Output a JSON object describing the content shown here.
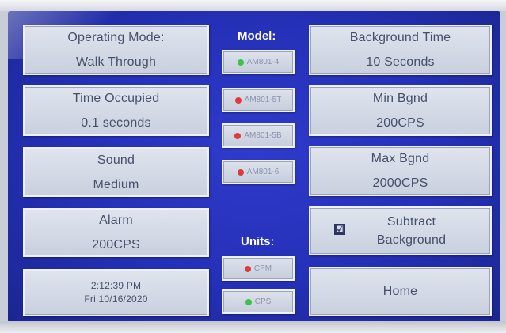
{
  "left": {
    "mode_label": "Operating Mode:",
    "mode_value": "Walk Through",
    "occupied_label": "Time Occupied",
    "occupied_value": "0.1 seconds",
    "sound_label": "Sound",
    "sound_value": "Medium",
    "alarm_label": "Alarm",
    "alarm_value": "200CPS",
    "clock_time": "2:12:39 PM",
    "clock_date": "Fri 10/16/2020"
  },
  "middle": {
    "model_header": "Model:",
    "models": [
      {
        "label": "AM801-4",
        "led": "#3cc24a"
      },
      {
        "label": "AM801-5T",
        "led": "#e03a3a"
      },
      {
        "label": "AM801-5B",
        "led": "#e03a3a"
      },
      {
        "label": "AM801-6",
        "led": "#e03a3a"
      }
    ],
    "units_header": "Units:",
    "units": [
      {
        "label": "CPM",
        "led": "#e03a3a"
      },
      {
        "label": "CPS",
        "led": "#3cc24a"
      }
    ]
  },
  "right": {
    "bg_time_label": "Background Time",
    "bg_time_value": "10 Seconds",
    "min_bgnd_label": "Min Bgnd",
    "min_bgnd_value": "200CPS",
    "max_bgnd_label": "Max Bgnd",
    "max_bgnd_value": "2000CPS",
    "subtract_line1": "Subtract",
    "subtract_line2": "Background",
    "subtract_checked": "☑",
    "home_label": "Home"
  },
  "colors": {
    "screen_blue": "#2430b6",
    "panel": "#d6dce8",
    "led_green": "#3cc24a",
    "led_red": "#e03a3a"
  }
}
